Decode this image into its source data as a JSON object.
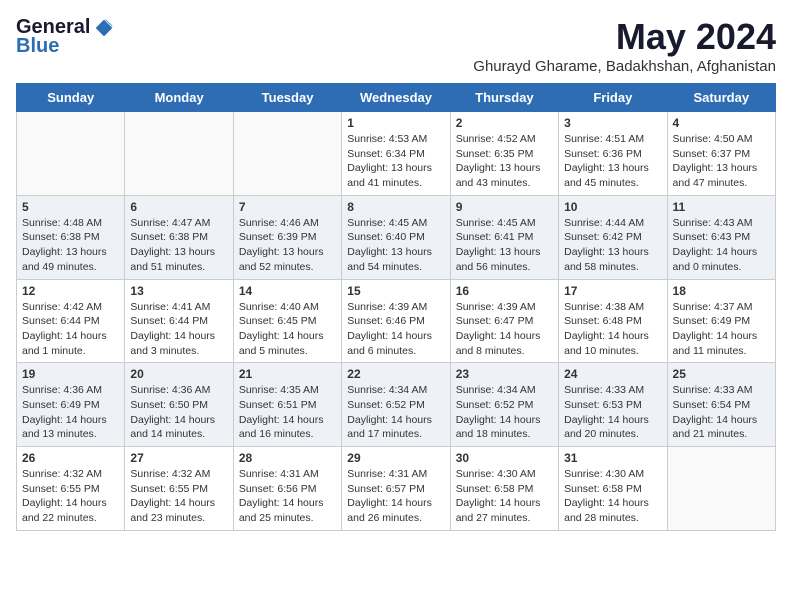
{
  "logo": {
    "general": "General",
    "blue": "Blue"
  },
  "title": "May 2024",
  "subtitle": "Ghurayd Gharame, Badakhshan, Afghanistan",
  "days_of_week": [
    "Sunday",
    "Monday",
    "Tuesday",
    "Wednesday",
    "Thursday",
    "Friday",
    "Saturday"
  ],
  "weeks": [
    [
      {
        "day": "",
        "info": ""
      },
      {
        "day": "",
        "info": ""
      },
      {
        "day": "",
        "info": ""
      },
      {
        "day": "1",
        "info": "Sunrise: 4:53 AM\nSunset: 6:34 PM\nDaylight: 13 hours and 41 minutes."
      },
      {
        "day": "2",
        "info": "Sunrise: 4:52 AM\nSunset: 6:35 PM\nDaylight: 13 hours and 43 minutes."
      },
      {
        "day": "3",
        "info": "Sunrise: 4:51 AM\nSunset: 6:36 PM\nDaylight: 13 hours and 45 minutes."
      },
      {
        "day": "4",
        "info": "Sunrise: 4:50 AM\nSunset: 6:37 PM\nDaylight: 13 hours and 47 minutes."
      }
    ],
    [
      {
        "day": "5",
        "info": "Sunrise: 4:48 AM\nSunset: 6:38 PM\nDaylight: 13 hours and 49 minutes."
      },
      {
        "day": "6",
        "info": "Sunrise: 4:47 AM\nSunset: 6:38 PM\nDaylight: 13 hours and 51 minutes."
      },
      {
        "day": "7",
        "info": "Sunrise: 4:46 AM\nSunset: 6:39 PM\nDaylight: 13 hours and 52 minutes."
      },
      {
        "day": "8",
        "info": "Sunrise: 4:45 AM\nSunset: 6:40 PM\nDaylight: 13 hours and 54 minutes."
      },
      {
        "day": "9",
        "info": "Sunrise: 4:45 AM\nSunset: 6:41 PM\nDaylight: 13 hours and 56 minutes."
      },
      {
        "day": "10",
        "info": "Sunrise: 4:44 AM\nSunset: 6:42 PM\nDaylight: 13 hours and 58 minutes."
      },
      {
        "day": "11",
        "info": "Sunrise: 4:43 AM\nSunset: 6:43 PM\nDaylight: 14 hours and 0 minutes."
      }
    ],
    [
      {
        "day": "12",
        "info": "Sunrise: 4:42 AM\nSunset: 6:44 PM\nDaylight: 14 hours and 1 minute."
      },
      {
        "day": "13",
        "info": "Sunrise: 4:41 AM\nSunset: 6:44 PM\nDaylight: 14 hours and 3 minutes."
      },
      {
        "day": "14",
        "info": "Sunrise: 4:40 AM\nSunset: 6:45 PM\nDaylight: 14 hours and 5 minutes."
      },
      {
        "day": "15",
        "info": "Sunrise: 4:39 AM\nSunset: 6:46 PM\nDaylight: 14 hours and 6 minutes."
      },
      {
        "day": "16",
        "info": "Sunrise: 4:39 AM\nSunset: 6:47 PM\nDaylight: 14 hours and 8 minutes."
      },
      {
        "day": "17",
        "info": "Sunrise: 4:38 AM\nSunset: 6:48 PM\nDaylight: 14 hours and 10 minutes."
      },
      {
        "day": "18",
        "info": "Sunrise: 4:37 AM\nSunset: 6:49 PM\nDaylight: 14 hours and 11 minutes."
      }
    ],
    [
      {
        "day": "19",
        "info": "Sunrise: 4:36 AM\nSunset: 6:49 PM\nDaylight: 14 hours and 13 minutes."
      },
      {
        "day": "20",
        "info": "Sunrise: 4:36 AM\nSunset: 6:50 PM\nDaylight: 14 hours and 14 minutes."
      },
      {
        "day": "21",
        "info": "Sunrise: 4:35 AM\nSunset: 6:51 PM\nDaylight: 14 hours and 16 minutes."
      },
      {
        "day": "22",
        "info": "Sunrise: 4:34 AM\nSunset: 6:52 PM\nDaylight: 14 hours and 17 minutes."
      },
      {
        "day": "23",
        "info": "Sunrise: 4:34 AM\nSunset: 6:52 PM\nDaylight: 14 hours and 18 minutes."
      },
      {
        "day": "24",
        "info": "Sunrise: 4:33 AM\nSunset: 6:53 PM\nDaylight: 14 hours and 20 minutes."
      },
      {
        "day": "25",
        "info": "Sunrise: 4:33 AM\nSunset: 6:54 PM\nDaylight: 14 hours and 21 minutes."
      }
    ],
    [
      {
        "day": "26",
        "info": "Sunrise: 4:32 AM\nSunset: 6:55 PM\nDaylight: 14 hours and 22 minutes."
      },
      {
        "day": "27",
        "info": "Sunrise: 4:32 AM\nSunset: 6:55 PM\nDaylight: 14 hours and 23 minutes."
      },
      {
        "day": "28",
        "info": "Sunrise: 4:31 AM\nSunset: 6:56 PM\nDaylight: 14 hours and 25 minutes."
      },
      {
        "day": "29",
        "info": "Sunrise: 4:31 AM\nSunset: 6:57 PM\nDaylight: 14 hours and 26 minutes."
      },
      {
        "day": "30",
        "info": "Sunrise: 4:30 AM\nSunset: 6:58 PM\nDaylight: 14 hours and 27 minutes."
      },
      {
        "day": "31",
        "info": "Sunrise: 4:30 AM\nSunset: 6:58 PM\nDaylight: 14 hours and 28 minutes."
      },
      {
        "day": "",
        "info": ""
      }
    ]
  ]
}
